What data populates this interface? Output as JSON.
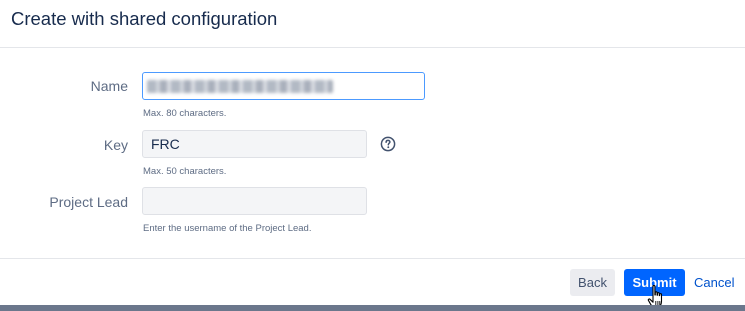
{
  "dialog": {
    "title": "Create with shared configuration"
  },
  "form": {
    "name": {
      "label": "Name",
      "value": "",
      "help": "Max. 80 characters."
    },
    "key": {
      "label": "Key",
      "value": "FRC",
      "help": "Max. 50 characters."
    },
    "project_lead": {
      "label": "Project Lead",
      "value": "",
      "help": "Enter the username of the Project Lead."
    }
  },
  "footer": {
    "back_label": "Back",
    "submit_label": "Submit",
    "cancel_label": "Cancel"
  },
  "icons": {
    "help": "question-circle-icon",
    "cursor": "hand-pointer-icon"
  },
  "colors": {
    "primary": "#0065ff",
    "link": "#0052cc",
    "focus_border": "#4c9aff",
    "label": "#5e6c84",
    "title": "#172b4d"
  }
}
